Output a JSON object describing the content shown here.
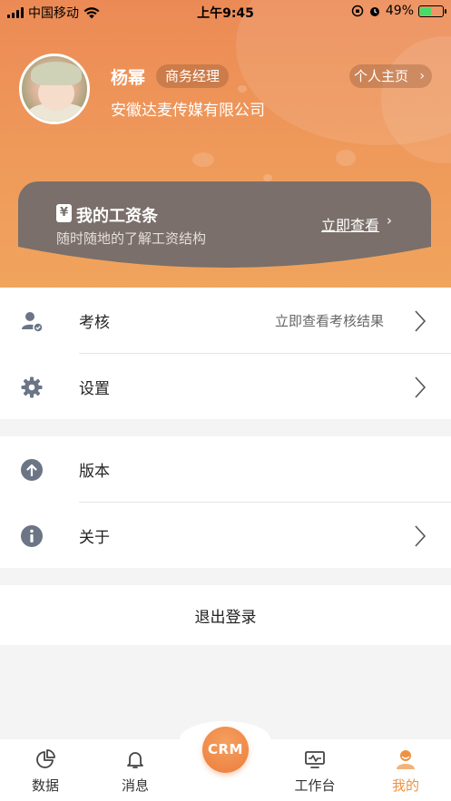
{
  "status_bar": {
    "carrier": "中国移动",
    "time": "上午9:45",
    "battery_percent": "49%"
  },
  "profile": {
    "name": "杨幂",
    "role": "商务经理",
    "company": "安徽达麦传媒有限公司",
    "homepage_button": "个人主页"
  },
  "salary_card": {
    "icon_text": "¥",
    "title": "我的工资条",
    "subtitle": "随时随地的了解工资结构",
    "link": "立即查看"
  },
  "menu_group_1": [
    {
      "label": "考核",
      "extra": "立即查看考核结果",
      "icon": "user-check-icon"
    },
    {
      "label": "设置",
      "extra": "",
      "icon": "gear-icon"
    }
  ],
  "menu_group_2": [
    {
      "label": "版本",
      "extra": "",
      "icon": "upload-arrow-icon"
    },
    {
      "label": "关于",
      "extra": "",
      "icon": "info-icon"
    }
  ],
  "logout": "退出登录",
  "tabbar": {
    "tabs": [
      {
        "label": "数据",
        "icon": "pie-chart-icon"
      },
      {
        "label": "消息",
        "icon": "bell-icon"
      },
      {
        "label": "工作台",
        "icon": "monitor-icon"
      },
      {
        "label": "我的",
        "icon": "person-icon",
        "active": true
      }
    ],
    "center_button": "CRM"
  },
  "colors": {
    "header_gradient_start": "#ec8a55",
    "header_gradient_end": "#f0a45c",
    "salary_card_bg": "#7a6f6a",
    "active_tab": "#ee9242",
    "icon_gray": "#6b7586"
  }
}
